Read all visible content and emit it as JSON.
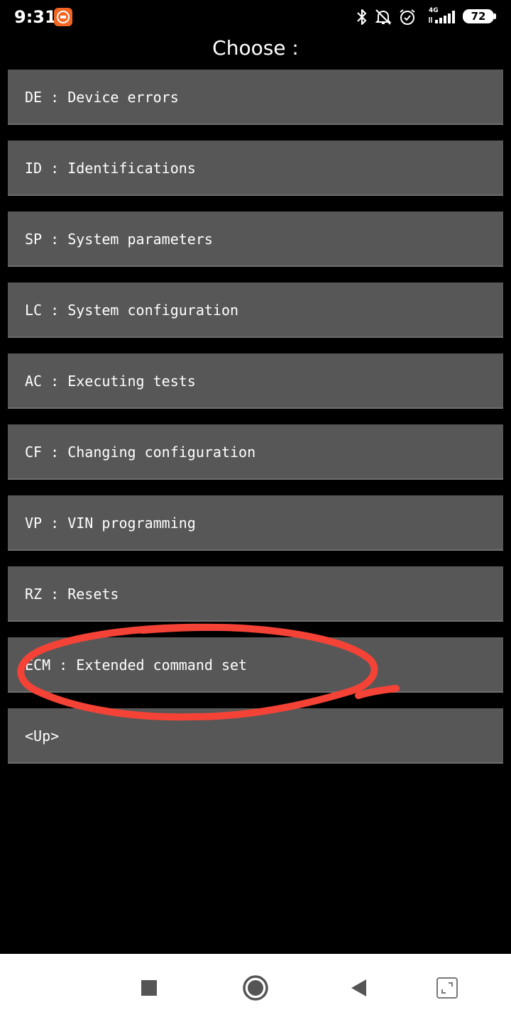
{
  "status_bar": {
    "time": "9:31",
    "network": "4G",
    "battery": "72",
    "icons": [
      "app-notification-icon",
      "bluetooth-icon",
      "silent-icon",
      "alarm-icon",
      "signal-icon",
      "battery-icon"
    ]
  },
  "page": {
    "title": "Choose :"
  },
  "menu": {
    "items": [
      {
        "label": "DE : Device errors"
      },
      {
        "label": "ID : Identifications"
      },
      {
        "label": "SP : System parameters"
      },
      {
        "label": "LC : System configuration"
      },
      {
        "label": "AC : Executing tests"
      },
      {
        "label": "CF : Changing configuration"
      },
      {
        "label": "VP : VIN programming"
      },
      {
        "label": "RZ : Resets"
      },
      {
        "label": "ECM : Extended command set"
      },
      {
        "label": "<Up>"
      }
    ]
  },
  "annotation": {
    "color": "#f44336",
    "shape": "hand-drawn-ellipse"
  },
  "nav_bar": {
    "icons": [
      "recents-square-icon",
      "home-circle-icon",
      "back-triangle-icon",
      "screen-rotate-icon"
    ]
  },
  "colors": {
    "background": "#000000",
    "item_background": "#575757",
    "text": "#ffffff",
    "nav_background": "#ffffff"
  }
}
